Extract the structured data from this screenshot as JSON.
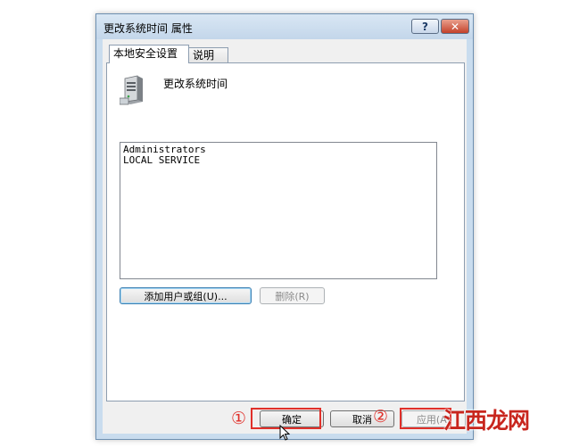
{
  "dialog": {
    "title": "更改系统时间 属性",
    "help_label": "?",
    "close_label": "✕"
  },
  "tabs": [
    {
      "label": "本地安全设置",
      "active": true
    },
    {
      "label": "说明",
      "active": false
    }
  ],
  "policy": {
    "icon": "server-icon",
    "name": "更改系统时间"
  },
  "members": [
    "Administrators",
    "LOCAL SERVICE"
  ],
  "buttons": {
    "add": "添加用户或组(U)...",
    "remove": "删除(R)",
    "ok": "确定",
    "cancel": "取消",
    "apply": "应用(A)"
  },
  "annotations": {
    "marker_1": "①",
    "marker_2": "②",
    "highlight_color": "#e0302a"
  },
  "watermark": "江西龙网"
}
